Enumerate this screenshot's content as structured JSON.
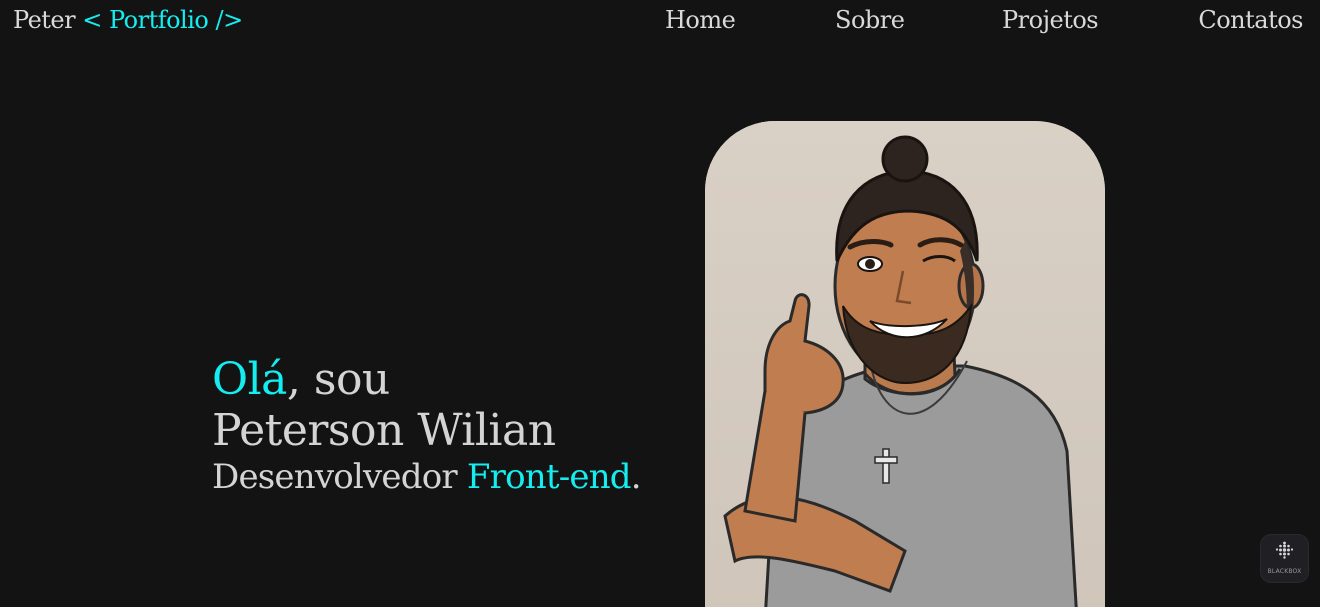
{
  "header": {
    "logo_name": "Peter",
    "logo_accent": "< Portfolio />"
  },
  "nav": {
    "home": "Home",
    "about": "Sobre",
    "projects": "Projetos",
    "contacts": "Contatos"
  },
  "hero": {
    "greeting_highlight": "Olá",
    "greeting_rest": ", sou",
    "name": "Peterson Wilian",
    "role_prefix": "Desenvolvedor ",
    "role_highlight": "Front-end",
    "role_suffix": "."
  },
  "badge": {
    "label": "BLACKBOX"
  },
  "colors": {
    "background": "#131314",
    "accent": "#15eef0",
    "text": "#d9d9d9"
  },
  "icons": {
    "portrait": "cartoon-avatar-thumbs-up",
    "badge": "blackbox-logo-icon"
  }
}
